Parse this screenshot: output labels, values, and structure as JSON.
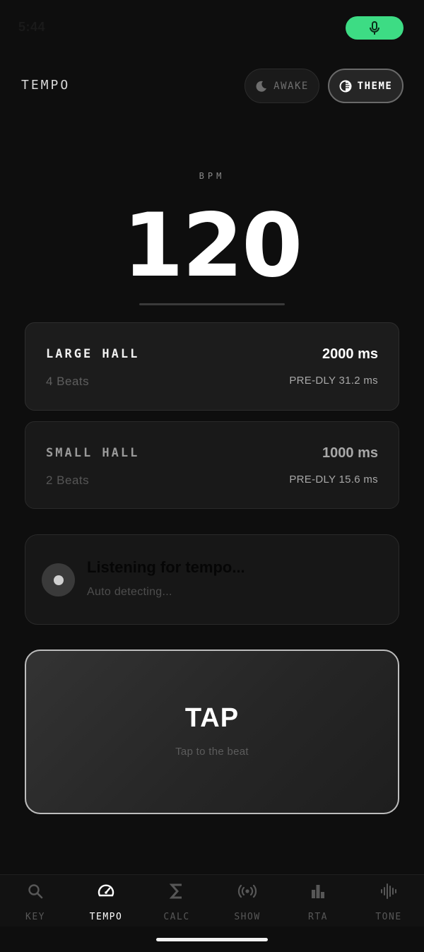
{
  "status_bar": {
    "time": "5:44"
  },
  "header": {
    "title": "TEMPO",
    "awake_label": "AWAKE",
    "theme_label": "THEME"
  },
  "bpm": {
    "label": "BPM",
    "value": "120"
  },
  "reverb_cards": [
    {
      "name": "LARGE HALL",
      "beats": "4 Beats",
      "ms": "2000 ms",
      "predelay": "PRE-DLY 31.2 ms"
    },
    {
      "name": "SMALL HALL",
      "beats": "2 Beats",
      "ms": "1000 ms",
      "predelay": "PRE-DLY 15.6 ms"
    }
  ],
  "listening": {
    "title": "Listening for tempo...",
    "subtitle": "Auto detecting..."
  },
  "tap": {
    "label": "TAP",
    "subtitle": "Tap to the beat"
  },
  "nav": {
    "active": "TEMPO",
    "items": [
      {
        "label": "KEY",
        "icon": "search-icon"
      },
      {
        "label": "TEMPO",
        "icon": "speedometer-icon"
      },
      {
        "label": "CALC",
        "icon": "sigma-icon"
      },
      {
        "label": "SHOW",
        "icon": "broadcast-icon"
      },
      {
        "label": "RTA",
        "icon": "bar-chart-icon"
      },
      {
        "label": "TONE",
        "icon": "waveform-icon"
      }
    ]
  },
  "colors": {
    "background": "#0e0e0e",
    "accent_green": "#3ddc84",
    "card": "#1c1c1c",
    "text_primary": "#ffffff",
    "text_muted": "#5e5e5e"
  }
}
